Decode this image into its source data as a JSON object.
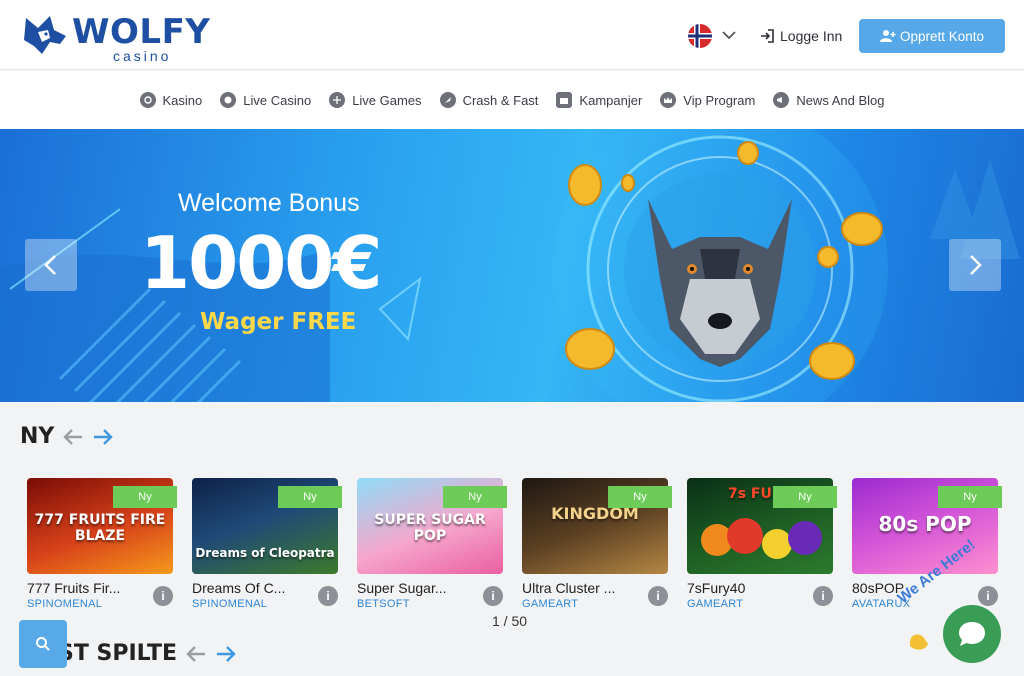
{
  "header": {
    "logo_word": "WOLFY",
    "logo_sub": "casino",
    "login_label": "Logge Inn",
    "signup_label": "Opprett Konto"
  },
  "nav": {
    "items": [
      {
        "label": "Kasino",
        "icon": "chip-icon"
      },
      {
        "label": "Live Casino",
        "icon": "roulette-icon"
      },
      {
        "label": "Live Games",
        "icon": "globe-icon"
      },
      {
        "label": "Crash & Fast",
        "icon": "rocket-icon"
      },
      {
        "label": "Kampanjer",
        "icon": "gift-icon"
      },
      {
        "label": "Vip Program",
        "icon": "crown-icon"
      },
      {
        "label": "News And Blog",
        "icon": "megaphone-icon"
      }
    ]
  },
  "banner": {
    "title": "Welcome Bonus",
    "amount": "1000€",
    "wager": "Wager FREE"
  },
  "sections": {
    "new_title": "NY",
    "recent_title": "ST SPILTE"
  },
  "games": [
    {
      "thumb_text": "777 FRUITS FIRE BLAZE",
      "name": "777 Fruits Fir...",
      "provider": "SPINOMENAL",
      "badge": "Ny",
      "color_a": "#c81d12",
      "color_b": "#f59a1c"
    },
    {
      "thumb_text": "Dreams of Cleopatra",
      "name": "Dreams Of C...",
      "provider": "SPINOMENAL",
      "badge": "Ny",
      "color_a": "#13305e",
      "color_b": "#3d7a2a"
    },
    {
      "thumb_text": "SUPER SUGAR POP",
      "name": "Super Sugar...",
      "provider": "BETSOFT",
      "badge": "Ny",
      "color_a": "#7bd2f4",
      "color_b": "#f06aa9"
    },
    {
      "thumb_text": "KINGDOM",
      "name": "Ultra Cluster ...",
      "provider": "GAMEART",
      "badge": "Ny",
      "color_a": "#2a2018",
      "color_b": "#b58744"
    },
    {
      "thumb_text": "7s FURY",
      "name": "7sFury40",
      "provider": "GAMEART",
      "badge": "Ny",
      "color_a": "#0e3a1c",
      "color_b": "#2d7a2d"
    },
    {
      "thumb_text": "80s POP",
      "name": "80sPOP",
      "provider": "AVATARUX",
      "badge": "Ny",
      "color_a": "#c03bd8",
      "color_b": "#ff86d0"
    }
  ],
  "pager": "1 / 50",
  "chat_tag": "We Are Here!",
  "colors": {
    "brand": "#1f4fa2",
    "accent": "#56a8e8",
    "new_badge": "#6ccc57",
    "provider": "#2e86d6",
    "chat": "#3a9d55"
  }
}
